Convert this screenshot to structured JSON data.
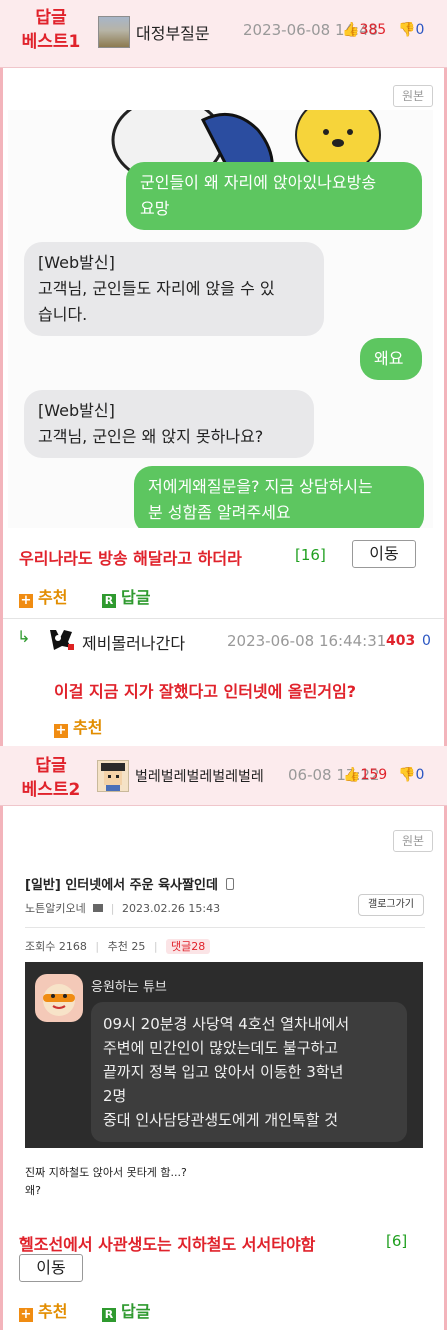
{
  "post1": {
    "badge_line1": "답글",
    "badge_line2": "베스트1",
    "username": "대정부질문",
    "date": "2023-06-08 14:48",
    "upvotes": "385",
    "downvotes": "0",
    "original_button": "원본",
    "chat": [
      {
        "side": "right",
        "text": "군인들이 왜 자리에 앉아있나요방송\n요망"
      },
      {
        "side": "left",
        "text": "[Web발신]\n고객님, 군인들도 자리에 앉을 수 있\n습니다."
      },
      {
        "side": "right",
        "text": "왜요"
      },
      {
        "side": "left",
        "text": "[Web발신]\n고객님, 군인은 왜 앉지 못하나요?"
      },
      {
        "side": "right",
        "text": "저에게왜질문을? 지금 상담하시는\n분 성함좀 알려주세요"
      }
    ],
    "caption": "우리나라도 방송 해달라고 하더라",
    "comment_count": "[16]",
    "move_button": "이동",
    "recommend_label": "추천",
    "reply_label": "답글"
  },
  "comment": {
    "arrow": "↳",
    "username": "제비몰러나간다",
    "date": "2023-06-08 16:44:31",
    "upvotes": "403",
    "downvotes": "0",
    "text": "이걸 지금 지가 잘했다고 인터넷에 올린거임?",
    "recommend_label": "추천"
  },
  "post2": {
    "badge_line1": "답글",
    "badge_line2": "베스트2",
    "username": "벌레벌레벌레벌레벌레",
    "date": "06-08 17:22",
    "upvotes": "159",
    "downvotes": "0",
    "original_button": "원본",
    "embed": {
      "title": "[일반] 인터넷에서 주운 육사짤인데",
      "author": "노튼알키오네",
      "date": "2023.02.26 15:43",
      "gallery_button": "갤로그가기",
      "views_label": "조회수 2168",
      "recommend_label": "추천 25",
      "reply_label": "댓글",
      "reply_count": "28",
      "sender_name": "응원하는 튜브",
      "message": "09시 20분경 사당역 4호선 열차내에서\n주변에 민간인이 많았는데도 불구하고\n끝까지 정복 입고 앉아서 이동한 3학년\n2명\n중대 인사담당관생도에게 개인톡할 것",
      "body_text": "진짜 지하철도 앉아서 못타게 함...?\n왜?"
    },
    "caption": "헬조선에서 사관생도는 지하철도 서서타야함",
    "comment_count": "[6]",
    "move_button": "이동",
    "recommend_label": "추천",
    "reply_label": "답글"
  },
  "colors": {
    "best_red": "#e0222b",
    "header_pink": "#fcebed",
    "recommend_orange": "#f08c12",
    "reply_green": "#2f9a2f",
    "chat_green": "#5dc660",
    "chat_gray": "#e8e8ea"
  }
}
